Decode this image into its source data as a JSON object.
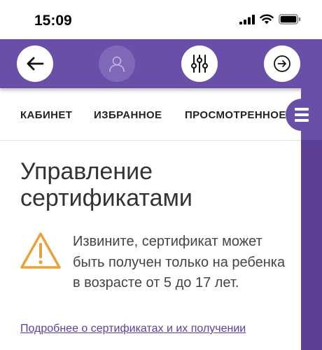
{
  "status_bar": {
    "time": "15:09"
  },
  "header": {
    "buttons": [
      "back-arrow-icon",
      "user-icon",
      "filters-icon",
      "forward-circle-icon"
    ]
  },
  "tabs": [
    {
      "label": "КАБИНЕТ"
    },
    {
      "label": "ИЗБРАННОЕ"
    },
    {
      "label": "ПРОСМОТРЕННОЕ"
    }
  ],
  "page": {
    "title_line1": "Управление",
    "title_line2": "сертификатами",
    "warning_text": "Извините, сертификат может быть получен только на ребенка в возрасте от 5 до 17 лет.",
    "link_text": "Подробнее о сертификатах и их получении"
  },
  "colors": {
    "accent": "#6a4fa8",
    "warning": "#e8a23a",
    "link": "#5b3fa0"
  }
}
